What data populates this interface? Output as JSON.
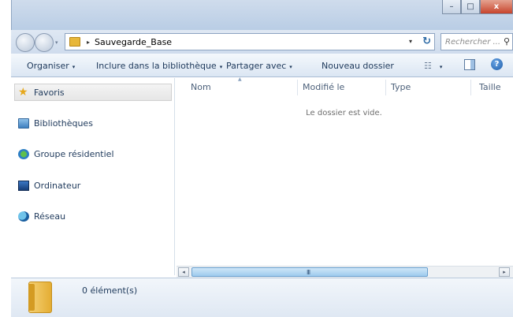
{
  "window": {
    "minimize_glyph": "–",
    "maximize_glyph": "□",
    "close_glyph": "x"
  },
  "address": {
    "separator": "▸",
    "path": "Sauvegarde_Base",
    "dropdown_glyph": "▾",
    "refresh_glyph": "↻"
  },
  "search": {
    "placeholder": "Rechercher ...",
    "icon_glyph": "⚲"
  },
  "toolbar": {
    "organize_label": "Organiser",
    "include_label": "Inclure dans la bibliothèque",
    "share_label": "Partager avec",
    "new_folder_label": "Nouveau dossier",
    "views_glyph": "☷",
    "dropdown_glyph": "▾",
    "help_glyph": "?"
  },
  "sidebar": {
    "items": [
      {
        "label": "Favoris",
        "icon": "star-icon",
        "selected": true
      },
      {
        "label": "Bibliothèques",
        "icon": "libraries-icon"
      },
      {
        "label": "Groupe résidentiel",
        "icon": "homegroup-icon"
      },
      {
        "label": "Ordinateur",
        "icon": "computer-icon"
      },
      {
        "label": "Réseau",
        "icon": "network-icon"
      }
    ]
  },
  "columns": {
    "name": "Nom",
    "modified": "Modifié le",
    "type": "Type",
    "size": "Taille",
    "sort_glyph": "▲"
  },
  "content": {
    "empty_message": "Le dossier est vide."
  },
  "scrollbar": {
    "left_glyph": "◂",
    "right_glyph": "▸",
    "grip_glyph": "III"
  },
  "details": {
    "item_count": "0 élément(s)"
  }
}
